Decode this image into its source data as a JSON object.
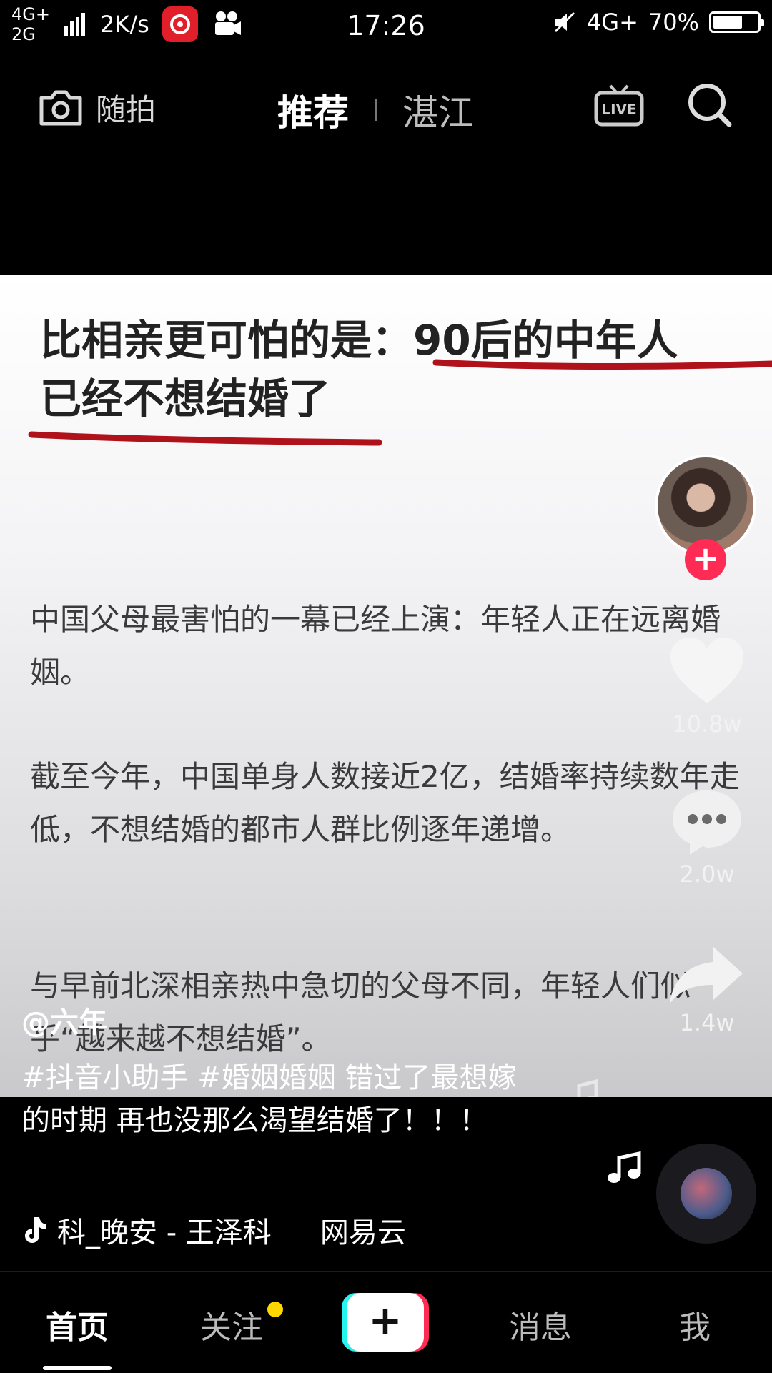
{
  "status_bar": {
    "signal_top": "4G+",
    "signal_bottom": "2G",
    "speed": "2K/s",
    "time": "17:26",
    "network": "4G+",
    "battery": "70%",
    "battery_level": 0.7
  },
  "top_nav": {
    "camera_label": "随拍",
    "tab_recommend": "推荐",
    "tab_city": "湛江"
  },
  "video": {
    "headline_line1": "比相亲更可怕的是：90后的中年人",
    "headline_line2": "已经不想结婚了",
    "paragraphs": [
      "中国父母最害怕的一幕已经上演：年轻人正在远离婚姻。",
      "截至今年，中国单身人数接近2亿，结婚率持续数年走低，不想结婚的都市人群比例逐年递增。",
      "与早前北深相亲热中急切的父母不同，年轻人们似乎“越来越不想结婚”。"
    ]
  },
  "actions": {
    "likes": "10.8w",
    "comments": "2.0w",
    "shares": "1.4w"
  },
  "caption": {
    "author": "@六年",
    "description": "#抖音小助手 #婚姻婚姻 错过了最想嫁的时期  再也没那么渴望结婚了！！！",
    "music": "科_晚安 - 王泽科",
    "music_source": "网易云"
  },
  "bottom_nav": {
    "home": "首页",
    "follow": "关注",
    "create": "+",
    "messages": "消息",
    "me": "我"
  },
  "colors": {
    "accent_red": "#fe2c55",
    "accent_cyan": "#25f4ee",
    "notify_yellow": "#ffd700",
    "underline_red": "#b0121b"
  }
}
